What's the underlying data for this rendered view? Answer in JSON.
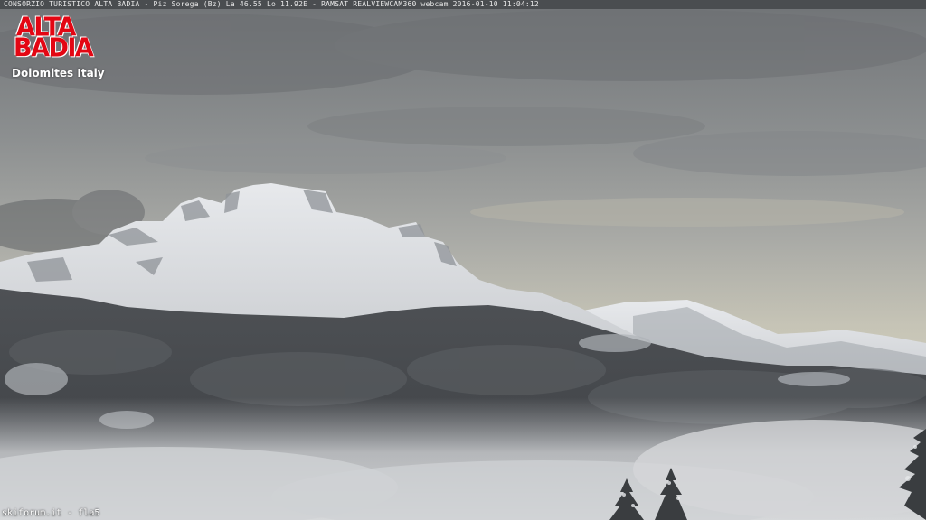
{
  "overlay": {
    "info_text": "CONSORZIO TURISTICO ALTA BADIA - Piz Sorega (Bz)  La 46.55 Lo 11.92E - RAMSAT REALVIEWCAM360 webcam 2016-01-10 11:04:12"
  },
  "logo": {
    "line1": "ALTA",
    "line2": "BADIA",
    "subtitle": "Dolomites Italy",
    "color": "#e30613"
  },
  "watermark": {
    "text": "skiforum.it - fla5"
  }
}
